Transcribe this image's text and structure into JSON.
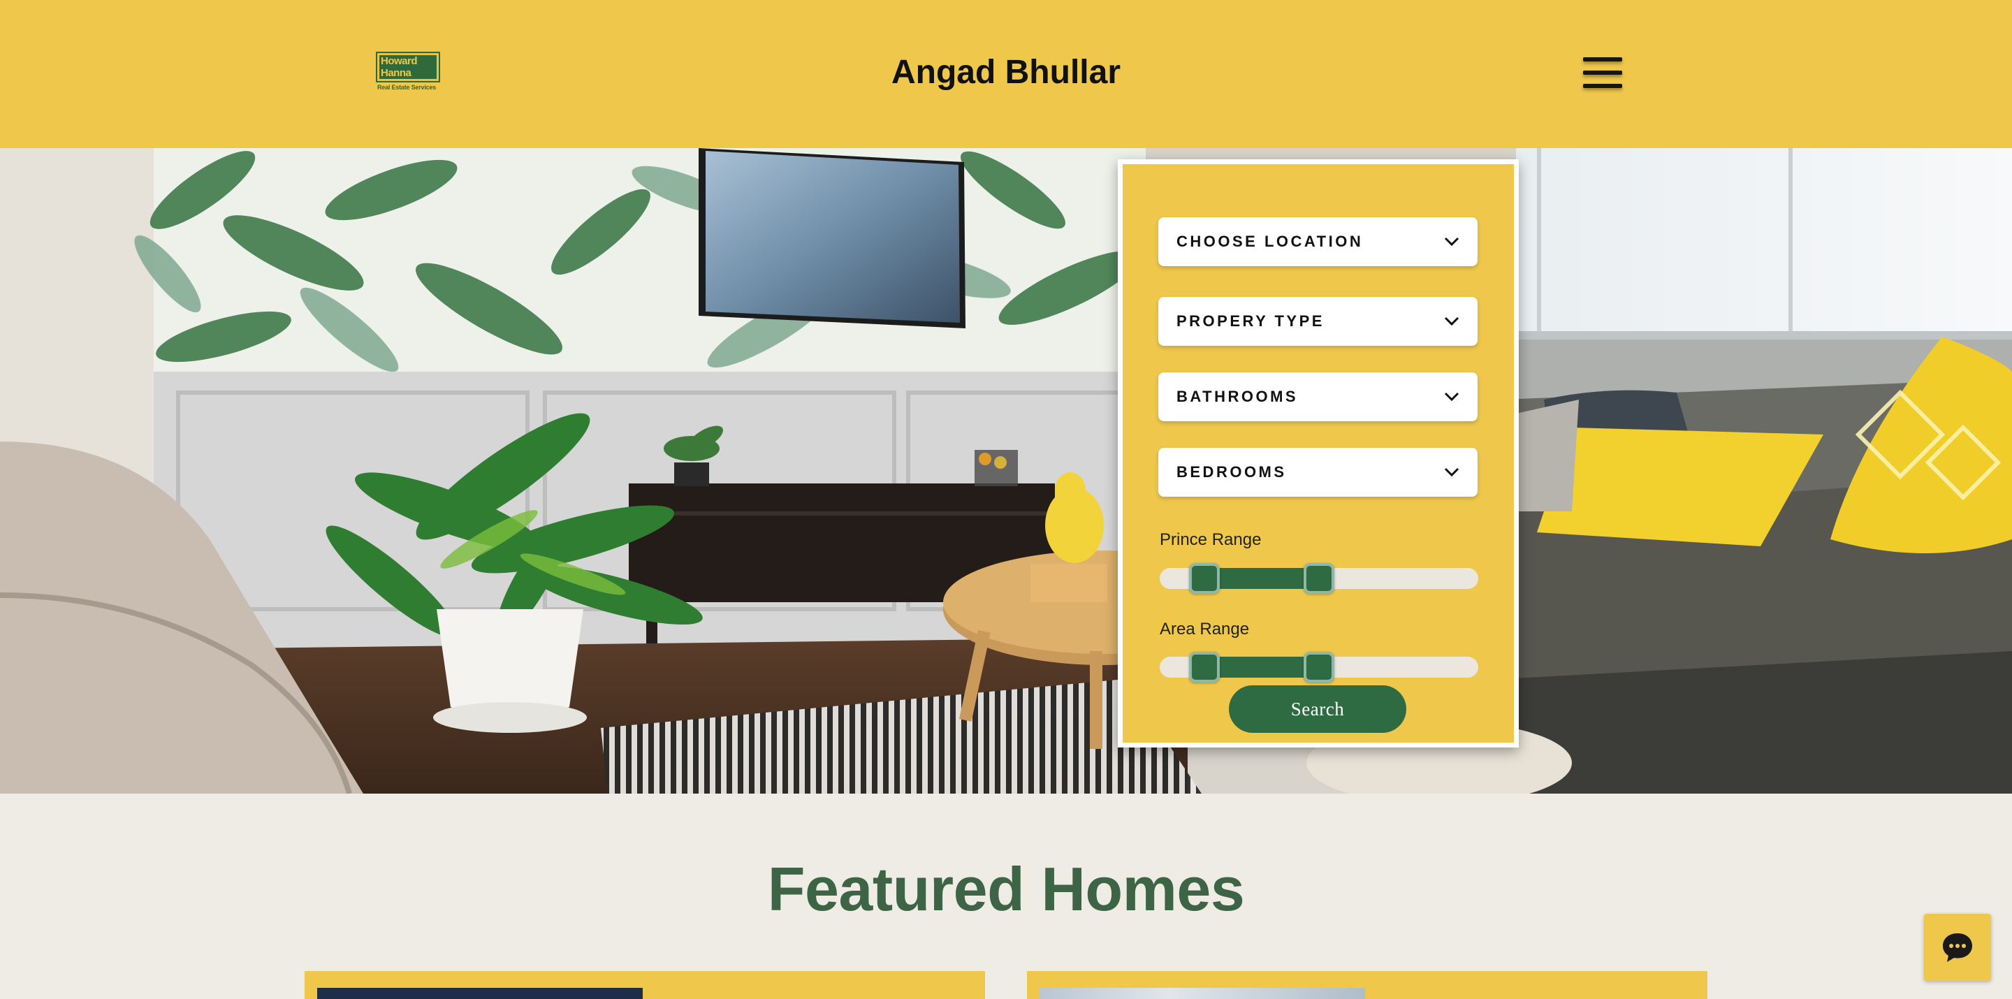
{
  "header": {
    "site_title": "Angad Bhullar",
    "logo": {
      "line1": "Howard",
      "line2": "Hanna",
      "tagline": "Real Estate Services"
    },
    "menu_icon": "hamburger-menu-icon"
  },
  "search": {
    "dropdowns": [
      {
        "label": "CHOOSE LOCATION"
      },
      {
        "label": "PROPERY TYPE"
      },
      {
        "label": "BATHROOMS"
      },
      {
        "label": "BEDROOMS"
      }
    ],
    "price_range": {
      "label": "Prince Range",
      "low_fraction": 0.14,
      "high_fraction": 0.5
    },
    "area_range": {
      "label": "Area Range",
      "low_fraction": 0.14,
      "high_fraction": 0.5
    },
    "button_label": "Search"
  },
  "featured": {
    "title": "Featured Homes"
  },
  "chat": {
    "icon": "chat-bubble-icon"
  },
  "colors": {
    "brand_yellow": "#eec74b",
    "brand_green": "#2e6b42",
    "heading_green": "#3d6545",
    "page_background": "#efebe5"
  }
}
